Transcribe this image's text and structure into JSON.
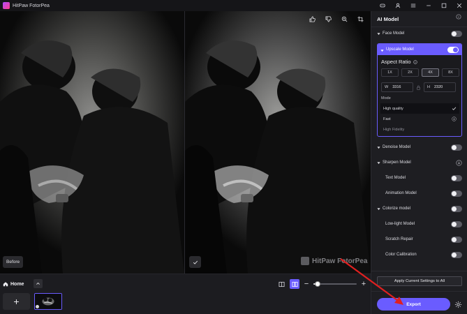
{
  "window": {
    "title": "HitPaw FotorPea"
  },
  "preview": {
    "before_label": "Before",
    "watermark": "HitPaw FotorPea"
  },
  "bottom_bar": {
    "home_tab": "Home",
    "add_label": "+",
    "zoom_level": 0.1
  },
  "sidebar": {
    "title": "AI Model",
    "face_model": "Face Model",
    "upscale_model": "Upscale Model",
    "aspect_ratio_title": "Aspect Ratio",
    "ratios": [
      "1X",
      "2X",
      "4X",
      "8X"
    ],
    "selected_ratio": "4X",
    "width_key": "W",
    "width_value": "3316",
    "height_key": "H",
    "height_value": "2320",
    "mode_label": "Mode",
    "modes": [
      "High quality",
      "Fast",
      "High Fidelity"
    ],
    "selected_mode": "High quality",
    "denoise_model": "Denoise Model",
    "sharpen_model": "Sharpen Model",
    "text_model": "Text Model",
    "animation_model": "Animation Model",
    "colorize_model": "Colorize model",
    "lowlight_model": "Low-light Model",
    "scratch_repair": "Scratch Repair",
    "color_calibration": "Color Calibration",
    "apply_button": "Apply Current Settings to All",
    "export_button": "Export"
  },
  "colors": {
    "accent": "#6a5cff",
    "annotation_arrow": "#e02020"
  }
}
